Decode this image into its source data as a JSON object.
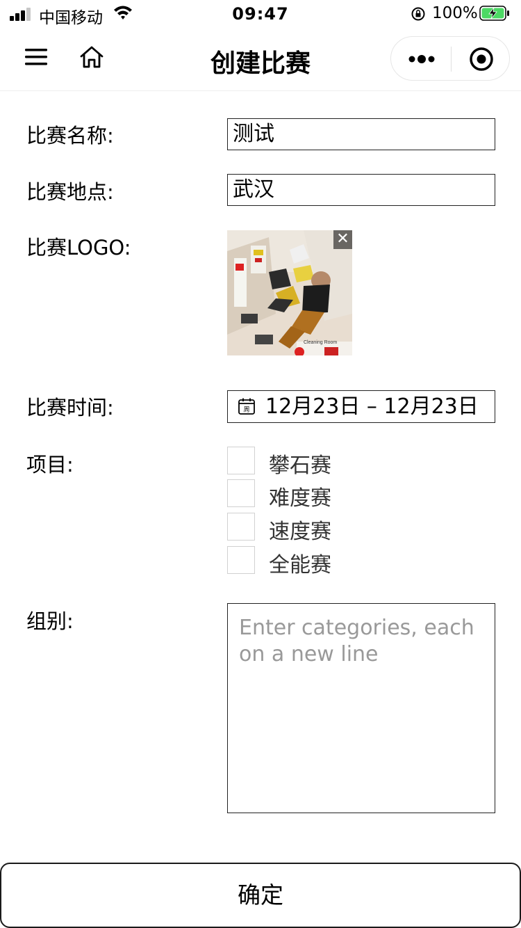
{
  "status_bar": {
    "carrier": "中国移动",
    "time": "09:47",
    "battery_percent": "100%",
    "battery_level": 1.0
  },
  "nav": {
    "title": "创建比赛"
  },
  "form": {
    "name_label": "比赛名称:",
    "name_value": "测试",
    "location_label": "比赛地点:",
    "location_value": "武汉",
    "logo_label": "比赛LOGO:",
    "logo_close": "✕",
    "time_label": "比赛时间:",
    "date_range": "12月23日 – 12月23日",
    "calendar_icon_text": "周",
    "events_label": "项目:",
    "events": [
      {
        "label": "攀石赛",
        "checked": false
      },
      {
        "label": "难度赛",
        "checked": false
      },
      {
        "label": "速度赛",
        "checked": false
      },
      {
        "label": "全能赛",
        "checked": false
      }
    ],
    "categories_label": "组别:",
    "categories_placeholder": "Enter categories, each on a new line"
  },
  "confirm_button": "确定",
  "colors": {
    "text": "#000000",
    "placeholder": "#999999",
    "border": "#222222",
    "checkbox_border": "#d1d1d1",
    "battery_green": "#4cd964"
  }
}
